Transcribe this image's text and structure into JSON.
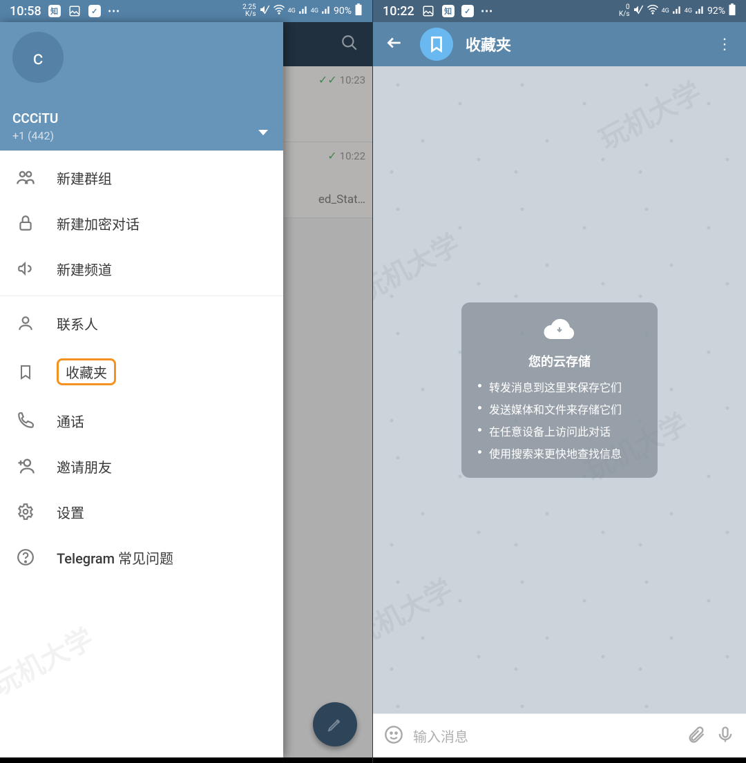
{
  "left": {
    "status": {
      "time": "10:58",
      "speed": "2.25",
      "speed_unit": "K/s",
      "net1": "4G",
      "net2": "4G",
      "battery": "90%"
    },
    "behind": {
      "row1_time": "10:23",
      "row2_time": "10:22",
      "row2_text": "ed_Stat…"
    },
    "account": {
      "initial": "c",
      "name": "CCCiTU",
      "phone": "+1 (442)"
    },
    "menu": {
      "new_group": "新建群组",
      "new_secret": "新建加密对话",
      "new_channel": "新建频道",
      "contacts": "联系人",
      "saved": "收藏夹",
      "calls": "通话",
      "invite": "邀请朋友",
      "settings": "设置",
      "faq": "Telegram 常见问题"
    }
  },
  "right": {
    "status": {
      "time": "10:22",
      "speed": "0",
      "speed_unit": "K/s",
      "net1": "4G",
      "net2": "4G",
      "battery": "92%"
    },
    "title": "收藏夹",
    "cloud": {
      "heading": "您的云存储",
      "items": [
        "转发消息到这里来保存它们",
        "发送媒体和文件来存储它们",
        "在任意设备上访问此对话",
        "使用搜索来更快地查找信息"
      ]
    },
    "input_placeholder": "输入消息"
  }
}
